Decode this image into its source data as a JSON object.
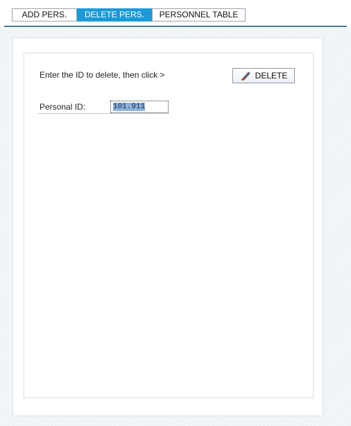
{
  "tabs": [
    {
      "label": "ADD PERS.",
      "active": false
    },
    {
      "label": "DELETE PERS.",
      "active": true
    },
    {
      "label": "PERSONNEL TABLE",
      "active": false
    }
  ],
  "form": {
    "instruction": "Enter the ID to delete, then click >",
    "delete_button": {
      "label": "DELETE",
      "icon": "eraser-icon"
    },
    "id_field": {
      "label": "Personal ID:",
      "value": "101.911"
    }
  },
  "colors": {
    "active_tab": "#1a9bd8",
    "tab_underline": "#4b7894",
    "selection": "#8fb3d9",
    "eraser_red": "#d9402b"
  }
}
